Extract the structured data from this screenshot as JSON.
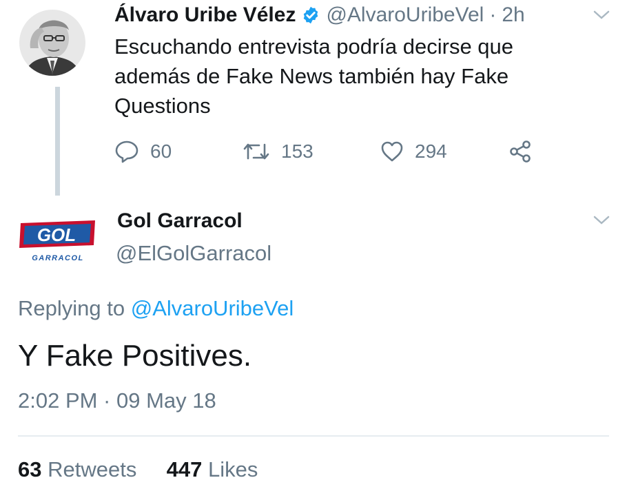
{
  "parent_tweet": {
    "display_name": "Álvaro Uribe Vélez",
    "handle": "@AlvaroUribeVel",
    "separator": "·",
    "time": "2h",
    "text": "Escuchando entrevista podría decirse que además de Fake News también hay Fake Questions",
    "reply_count": "60",
    "retweet_count": "153",
    "like_count": "294",
    "icons": [
      "reply-icon",
      "retweet-icon",
      "like-icon",
      "share-icon",
      "verified-badge-icon",
      "chevron-down-icon"
    ]
  },
  "reply_tweet": {
    "display_name": "Gol Garracol",
    "handle": "@ElGolGarracol",
    "logo": {
      "main_text": "GOL",
      "sub_text": "GARRACOL"
    },
    "replying_prefix": "Replying to",
    "replying_to": "@AlvaroUribeVel",
    "text": "Y Fake Positives.",
    "timestamp": "2:02 PM · 09 May 18",
    "retweets_count": "63",
    "retweets_label": "Retweets",
    "likes_count": "447",
    "likes_label": "Likes"
  },
  "colors": {
    "text": "#14171a",
    "secondary": "#657786",
    "link": "#1da1f2",
    "verified": "#1da1f2",
    "logo_red": "#c8102e",
    "logo_blue": "#1f5aa6"
  }
}
